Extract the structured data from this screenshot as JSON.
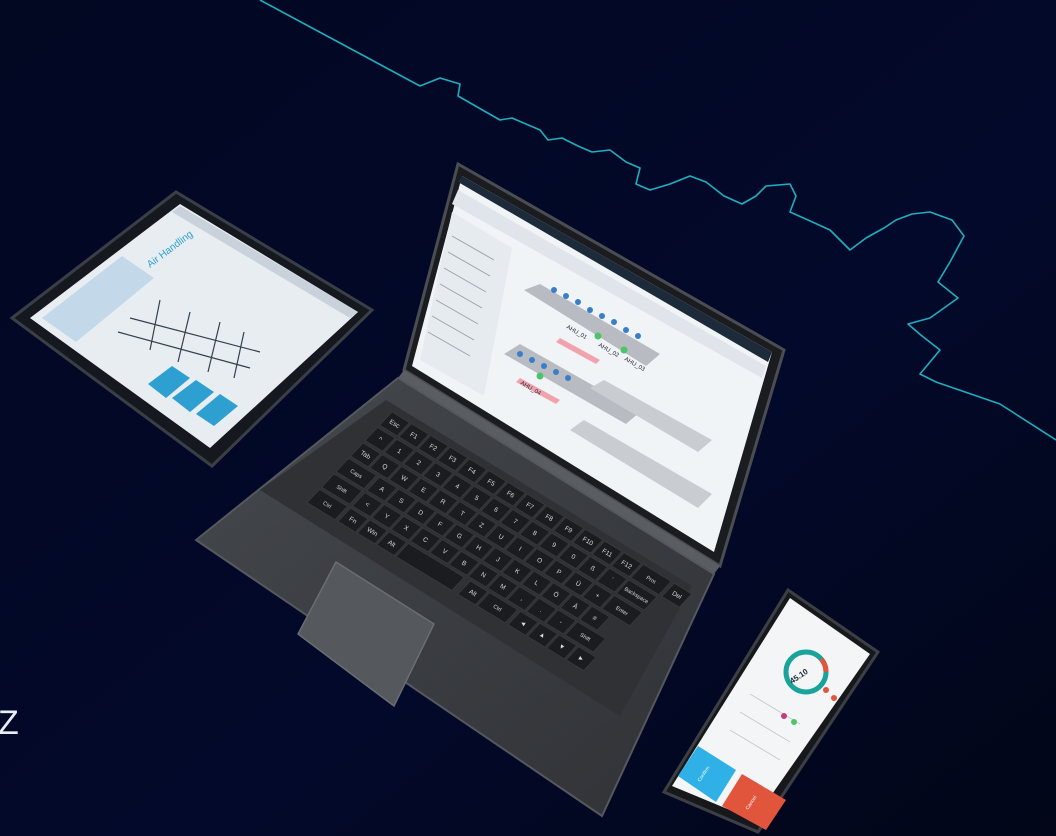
{
  "stray_text": "Z",
  "colors": {
    "background": "#020722",
    "skyline": "#1fb8c7",
    "device_body": "#3a3d42",
    "key": "#1b1c1f",
    "app_accent": "#2d9fd1",
    "phone_gauge": "#1aa39b",
    "phone_button_primary": "#2fb0e6",
    "phone_button_secondary": "#e2553d"
  },
  "tablet": {
    "app_title": "Air Handling"
  },
  "laptop": {
    "units": [
      "AHU_01",
      "AHU_02",
      "AHU_03",
      "AHU_04"
    ],
    "keyboard": {
      "fn_row": [
        "Esc",
        "F1",
        "F2",
        "F3",
        "F4",
        "F5",
        "F6",
        "F7",
        "F8",
        "F9",
        "F10",
        "F11",
        "F12",
        "Prnt",
        "Del"
      ],
      "row1": [
        "^",
        "1",
        "2",
        "3",
        "4",
        "5",
        "6",
        "7",
        "8",
        "9",
        "0",
        "ß",
        "´",
        "Backspace"
      ],
      "row2": [
        "Tab",
        "Q",
        "W",
        "E",
        "R",
        "T",
        "Z",
        "U",
        "I",
        "O",
        "P",
        "Ü",
        "+",
        "Enter"
      ],
      "row3": [
        "Caps",
        "A",
        "S",
        "D",
        "F",
        "G",
        "H",
        "J",
        "K",
        "L",
        "Ö",
        "Ä",
        "#"
      ],
      "row4": [
        "Shift",
        "<",
        "Y",
        "X",
        "C",
        "V",
        "B",
        "N",
        "M",
        ",",
        ".",
        "-",
        "Shift"
      ],
      "row5": [
        "Ctrl",
        "Fn",
        "Win",
        "Alt",
        "",
        "Alt",
        "Ctrl",
        "◄",
        "▲",
        "▼",
        "►"
      ]
    }
  },
  "phone": {
    "gauge_value": "45.10",
    "button_primary": "Confirm",
    "button_secondary": "Cancel"
  }
}
